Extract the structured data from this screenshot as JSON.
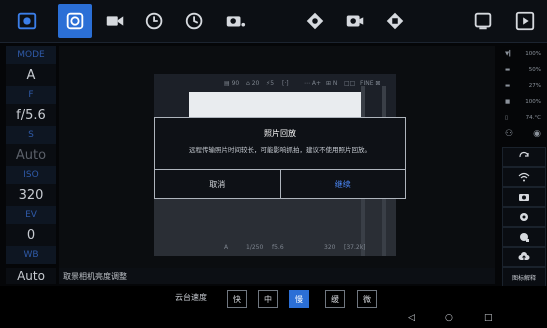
{
  "colors": {
    "accent": "#2b6fd6",
    "confirm": "#4d8cff",
    "label": "#2f5aa8"
  },
  "toolbar": {
    "icons": [
      "camera-settings-icon",
      "photo-mode-icon",
      "video-icon",
      "timelapse-icon",
      "interval-icon",
      "burst-icon",
      "night-icon",
      "drone-icon",
      "video-record-icon",
      "drone-panorama-icon",
      "window-icon",
      "play-icon"
    ],
    "active_index": 1
  },
  "params": [
    {
      "label": "MODE",
      "value": "A",
      "dim": false
    },
    {
      "label": "F",
      "value": "f/5.6",
      "dim": false
    },
    {
      "label": "S",
      "value": "Auto",
      "dim": true
    },
    {
      "label": "ISO",
      "value": "320",
      "dim": false
    },
    {
      "label": "EV",
      "value": "0",
      "dim": false
    },
    {
      "label": "WB",
      "value": "Auto",
      "dim": false
    }
  ],
  "viewer": {
    "status_text": "取景相机亮度调整",
    "osd_top": [
      "▤ 90",
      "⌂ 20",
      "⚡5",
      "[·]",
      "⋯ A+",
      "⊞ N",
      "□□",
      "FINE ⊠"
    ],
    "osd_bottom": [
      "A",
      "1/250",
      "f5.6",
      "320",
      "[37.2k]"
    ]
  },
  "dialog": {
    "title": "照片回放",
    "message": "远程传输照片时间较长，可能影响抓拍，建议不使用照片回放。",
    "cancel": "取消",
    "confirm": "继续"
  },
  "right_panel": {
    "signal": "100%",
    "battery1": "50%",
    "battery2": "27%",
    "battery3": "100%",
    "temp": "74.°C",
    "focus_label": "图标解释"
  },
  "speed": {
    "label": "云台速度",
    "options": [
      "快",
      "中",
      "慢",
      "缓",
      "微"
    ],
    "active_index": 2
  },
  "nav": {
    "back": "◁",
    "home": "○",
    "recent": "□"
  }
}
